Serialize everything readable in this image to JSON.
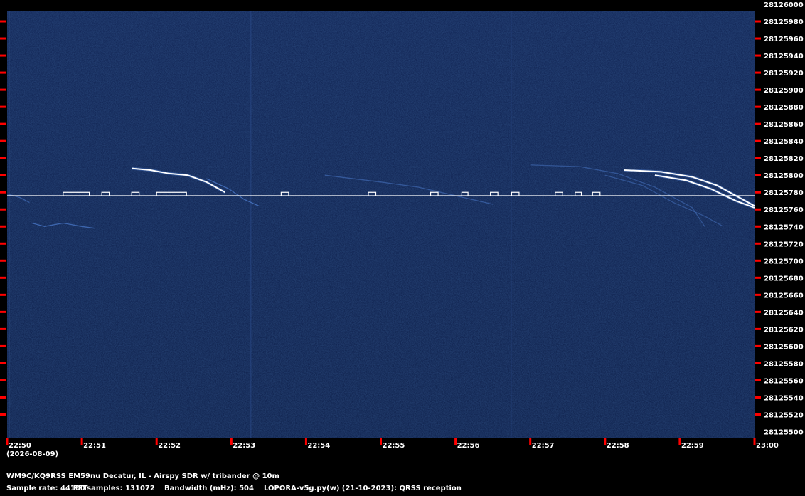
{
  "chart_data": {
    "type": "heatmap",
    "title": "",
    "xlabel": "",
    "ylabel": "",
    "date": "(2026-08-09)",
    "x_ticks": [
      "22:50",
      "22:51",
      "22:52",
      "22:53",
      "22:54",
      "22:55",
      "22:56",
      "22:57",
      "22:58",
      "22:59",
      "23:00"
    ],
    "x_range": [
      "22:50",
      "23:00"
    ],
    "y_ticks": [
      28126000,
      28125980,
      28125960,
      28125940,
      28125920,
      28125900,
      28125880,
      28125860,
      28125840,
      28125820,
      28125800,
      28125780,
      28125760,
      28125740,
      28125720,
      28125700,
      28125680,
      28125660,
      28125640,
      28125620,
      28125600,
      28125580,
      28125560,
      28125540,
      28125520,
      28125500
    ],
    "y_range": [
      28125490,
      28126000
    ],
    "colors": {
      "background": "#0d1f4a",
      "signal": "#ffffff",
      "tick": "#ff0000",
      "faint_trace": "#4a78c8"
    },
    "carrier": {
      "freq": 28125776,
      "x_range": [
        "22:50",
        "23:00"
      ]
    },
    "qrss_keying": {
      "low": 28125776,
      "high": 28125780,
      "segments": [
        [
          "22:50:45",
          "22:51:06"
        ],
        [
          "22:51:16",
          "22:51:22"
        ],
        [
          "22:51:40",
          "22:51:46"
        ],
        [
          "22:52:00",
          "22:52:24"
        ],
        [
          "22:53:40",
          "22:53:46"
        ],
        [
          "22:54:50",
          "22:54:56"
        ],
        [
          "22:55:40",
          "22:55:46"
        ],
        [
          "22:56:05",
          "22:56:10"
        ],
        [
          "22:56:28",
          "22:56:34"
        ],
        [
          "22:56:45",
          "22:56:51"
        ],
        [
          "22:57:20",
          "22:57:26"
        ],
        [
          "22:57:36",
          "22:57:41"
        ],
        [
          "22:57:50",
          "22:57:56"
        ]
      ]
    },
    "doppler_traces": [
      {
        "name": "",
        "brightness": 1.0,
        "points": [
          [
            "22:58:15",
            28125806
          ],
          [
            "22:58:45",
            28125804
          ],
          [
            "22:59:10",
            28125798
          ],
          [
            "22:59:30",
            28125788
          ],
          [
            "22:59:50",
            28125772
          ],
          [
            "23:00:00",
            28125764
          ]
        ]
      },
      {
        "name": "",
        "brightness": 0.85,
        "points": [
          [
            "22:58:40",
            28125800
          ],
          [
            "22:59:05",
            28125794
          ],
          [
            "22:59:25",
            28125784
          ],
          [
            "22:59:45",
            28125770
          ],
          [
            "23:00:00",
            28125762
          ]
        ]
      },
      {
        "name": "",
        "brightness": 0.9,
        "points": [
          [
            "22:51:40",
            28125808
          ],
          [
            "22:51:55",
            28125806
          ],
          [
            "22:52:10",
            28125802
          ],
          [
            "22:52:25",
            28125800
          ],
          [
            "22:52:40",
            28125792
          ],
          [
            "22:52:55",
            28125780
          ]
        ]
      },
      {
        "name": "",
        "brightness": 0.6,
        "points": [
          [
            "22:52:40",
            28125796
          ],
          [
            "22:52:58",
            28125784
          ],
          [
            "22:53:10",
            28125772
          ],
          [
            "22:53:22",
            28125764
          ]
        ]
      },
      {
        "name": "",
        "brightness": 0.55,
        "points": [
          [
            "22:50:20",
            28125744
          ],
          [
            "22:50:30",
            28125740
          ],
          [
            "22:50:45",
            28125744
          ],
          [
            "22:51:00",
            28125740
          ],
          [
            "22:51:10",
            28125738
          ]
        ]
      },
      {
        "name": "",
        "brightness": 0.4,
        "points": [
          [
            "22:50:00",
            28125778
          ],
          [
            "22:50:10",
            28125774
          ],
          [
            "22:50:18",
            28125768
          ]
        ]
      },
      {
        "name": "",
        "brightness": 0.35,
        "points": [
          [
            "22:54:15",
            28125800
          ],
          [
            "22:55:00",
            28125792
          ],
          [
            "22:55:30",
            28125786
          ],
          [
            "22:56:00",
            28125776
          ],
          [
            "22:56:30",
            28125766
          ]
        ]
      },
      {
        "name": "",
        "brightness": 0.3,
        "points": [
          [
            "22:57:00",
            28125812
          ],
          [
            "22:57:40",
            28125810
          ],
          [
            "22:58:10",
            28125802
          ],
          [
            "22:58:40",
            28125786
          ],
          [
            "22:59:10",
            28125762
          ],
          [
            "22:59:20",
            28125740
          ]
        ]
      },
      {
        "name": "",
        "brightness": 0.3,
        "points": [
          [
            "22:58:00",
            28125800
          ],
          [
            "22:58:30",
            28125788
          ],
          [
            "22:58:55",
            28125768
          ],
          [
            "22:59:20",
            28125752
          ],
          [
            "22:59:35",
            28125740
          ]
        ]
      }
    ]
  },
  "footer": {
    "station": "WM9C/KQ9RSS EM59nu Decatur, IL - Airspy SDR w/ tribander @ 10m",
    "sample_rate": "Sample rate: 44100",
    "fft_samples": "FFTsamples: 131072",
    "bandwidth": "Bandwidth (mHz): 504",
    "software": "LOPORA-v5g.py(w) (21-10-2023): QRSS reception"
  }
}
